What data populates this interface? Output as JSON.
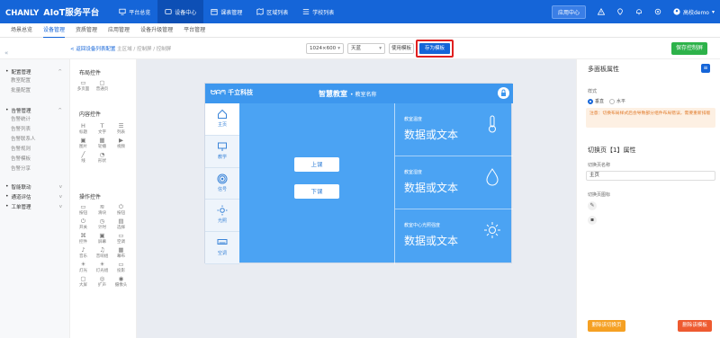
{
  "brand": {
    "name": "CHANLY",
    "product": "AIoT服务平台"
  },
  "nav": [
    {
      "label": "平台总览",
      "icon": "monitor-icon"
    },
    {
      "label": "设备中心",
      "icon": "device-icon"
    },
    {
      "label": "课表管理",
      "icon": "schedule-icon"
    },
    {
      "label": "区域列表",
      "icon": "map-icon"
    },
    {
      "label": "学校列表",
      "icon": "list-icon"
    }
  ],
  "topright": {
    "app_center": "应用中心",
    "user": "高校demo"
  },
  "subnav": [
    "场景总览",
    "设备管理",
    "资质管理",
    "应用管理",
    "设备升级管理",
    "平台管理"
  ],
  "toolbar": {
    "back_link": "< 返回设备列表配置",
    "crumb_rest": "主区域 / 控制屏 / 控制屏",
    "resolution": "1024×600",
    "theme": "天蓝",
    "use_template": "使用模板",
    "save_template": "存为模板",
    "save_control": "保存控制屏"
  },
  "leftmenu": {
    "groups": [
      {
        "label": "配置管理",
        "items": [
          "教室配置",
          "批量配置"
        ]
      },
      {
        "label": "告警管理",
        "items": [
          "告警统计",
          "告警列表",
          "告警联系人",
          "告警规则",
          "告警模板",
          "告警分享"
        ]
      },
      {
        "label": "智能联动",
        "items": []
      },
      {
        "label": "通道评估",
        "items": []
      },
      {
        "label": "工单管理",
        "items": []
      }
    ]
  },
  "widgets": {
    "layout_title": "布局控件",
    "layout": [
      {
        "g": "▭",
        "t": "多页面"
      },
      {
        "g": "▢",
        "t": "普通页"
      }
    ],
    "content_title": "内容控件",
    "content": [
      {
        "g": "H",
        "t": "标题"
      },
      {
        "g": "T",
        "t": "文字"
      },
      {
        "g": "☰",
        "t": "列表"
      },
      {
        "g": "▣",
        "t": "图片"
      },
      {
        "g": "▦",
        "t": "轮播"
      },
      {
        "g": "▶",
        "t": "视频"
      },
      {
        "g": "╱",
        "t": "线"
      },
      {
        "g": "◔",
        "t": "形状"
      }
    ],
    "action_title": "操作控件",
    "action": [
      {
        "g": "▭",
        "t": "按钮"
      },
      {
        "g": "≋",
        "t": "滑块"
      },
      {
        "g": "⏻",
        "t": "按钮"
      },
      {
        "g": "⏻",
        "t": "开关"
      },
      {
        "g": "◷",
        "t": "计时"
      },
      {
        "g": "▤",
        "t": "选择"
      },
      {
        "g": "⌘",
        "t": "控件"
      },
      {
        "g": "▣",
        "t": "屏幕"
      },
      {
        "g": "▭",
        "t": "空调"
      },
      {
        "g": "♪",
        "t": "音乐"
      },
      {
        "g": "♫",
        "t": "音响组"
      },
      {
        "g": "▦",
        "t": "幕布"
      },
      {
        "g": "☀",
        "t": "灯光"
      },
      {
        "g": "☀",
        "t": "灯光组"
      },
      {
        "g": "▭",
        "t": "投影"
      },
      {
        "g": "▢",
        "t": "大屏"
      },
      {
        "g": "◎",
        "t": "扩声"
      },
      {
        "g": "◉",
        "t": "摄像头"
      }
    ]
  },
  "screen": {
    "logo": "千立科技",
    "logo_sub": "",
    "title": "智慧教室",
    "subtitle": "• 教室名称",
    "side": [
      "主页",
      "教学",
      "信号",
      "光照",
      "空调"
    ],
    "buttons": [
      "上课",
      "下课"
    ],
    "cards": [
      {
        "caption": "教室温度",
        "value": "数据或文本"
      },
      {
        "caption": "教室湿度",
        "value": "数据或文本"
      },
      {
        "caption": "教室中心光照强度",
        "value": "数据或文本"
      }
    ]
  },
  "props": {
    "title": "多面板属性",
    "style_label": "样式",
    "opt_vertical": "垂直",
    "opt_horizontal": "水平",
    "notice": "注意：切换布局样式后会导致部分组件布局错误，需要重新排版",
    "switch_title": "切换页【1】属性",
    "name_label": "切换页名称",
    "name_value": "主页",
    "icon_label": "切换页图标",
    "del_page": "删除该切换页",
    "del_tpl": "删除该模板"
  },
  "colors": {
    "primary": "#1565d8",
    "screen": "#4ba3f3",
    "save": "#2db24a"
  }
}
